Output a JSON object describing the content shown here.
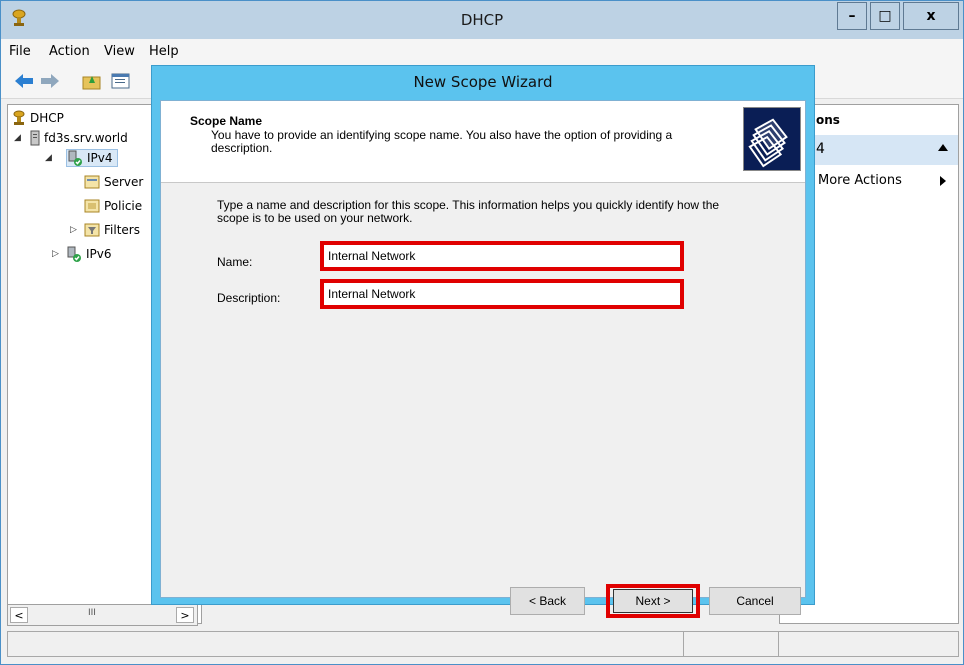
{
  "window": {
    "title": "DHCP",
    "buttons": {
      "minimize": "–",
      "maximize": "□",
      "close": "x"
    }
  },
  "menu": [
    "File",
    "Action",
    "View",
    "Help"
  ],
  "tree": {
    "items": [
      {
        "label": "DHCP",
        "icon": "dhcp-icon"
      },
      {
        "label": "fd3s.srv.world",
        "icon": "server-icon",
        "expander": "◢"
      },
      {
        "label": "IPv4",
        "icon": "ipv4-icon",
        "expander": "◢"
      },
      {
        "label": "Server",
        "icon": "server-options-icon"
      },
      {
        "label": "Policie",
        "icon": "policies-icon"
      },
      {
        "label": "Filters",
        "icon": "filters-icon",
        "expander": "▷"
      },
      {
        "label": "IPv6",
        "icon": "ipv6-icon",
        "expander": "▷"
      }
    ],
    "hscroll": {
      "left": "<",
      "thumb": "III",
      "right": ">"
    }
  },
  "actions": {
    "header": "ons",
    "section": "4",
    "more_actions": "More Actions"
  },
  "wizard": {
    "title": "New Scope Wizard",
    "header_title": "Scope Name",
    "header_desc": "You have to provide an identifying scope name. You also have the option of providing a description.",
    "intro": "Type a name and description for this scope. This information helps you quickly identify how the scope is to be used on your network.",
    "name_label": "Name:",
    "name_value": "Internal Network",
    "description_label": "Description:",
    "description_value": "Internal Network",
    "back_label": "< Back",
    "next_label": "Next >",
    "cancel_label": "Cancel"
  },
  "colors": {
    "wizard_frame": "#5bc3ee",
    "highlight": "#e00000",
    "title_bar": "#bdd2e4",
    "selection": "#d6e6f5"
  }
}
